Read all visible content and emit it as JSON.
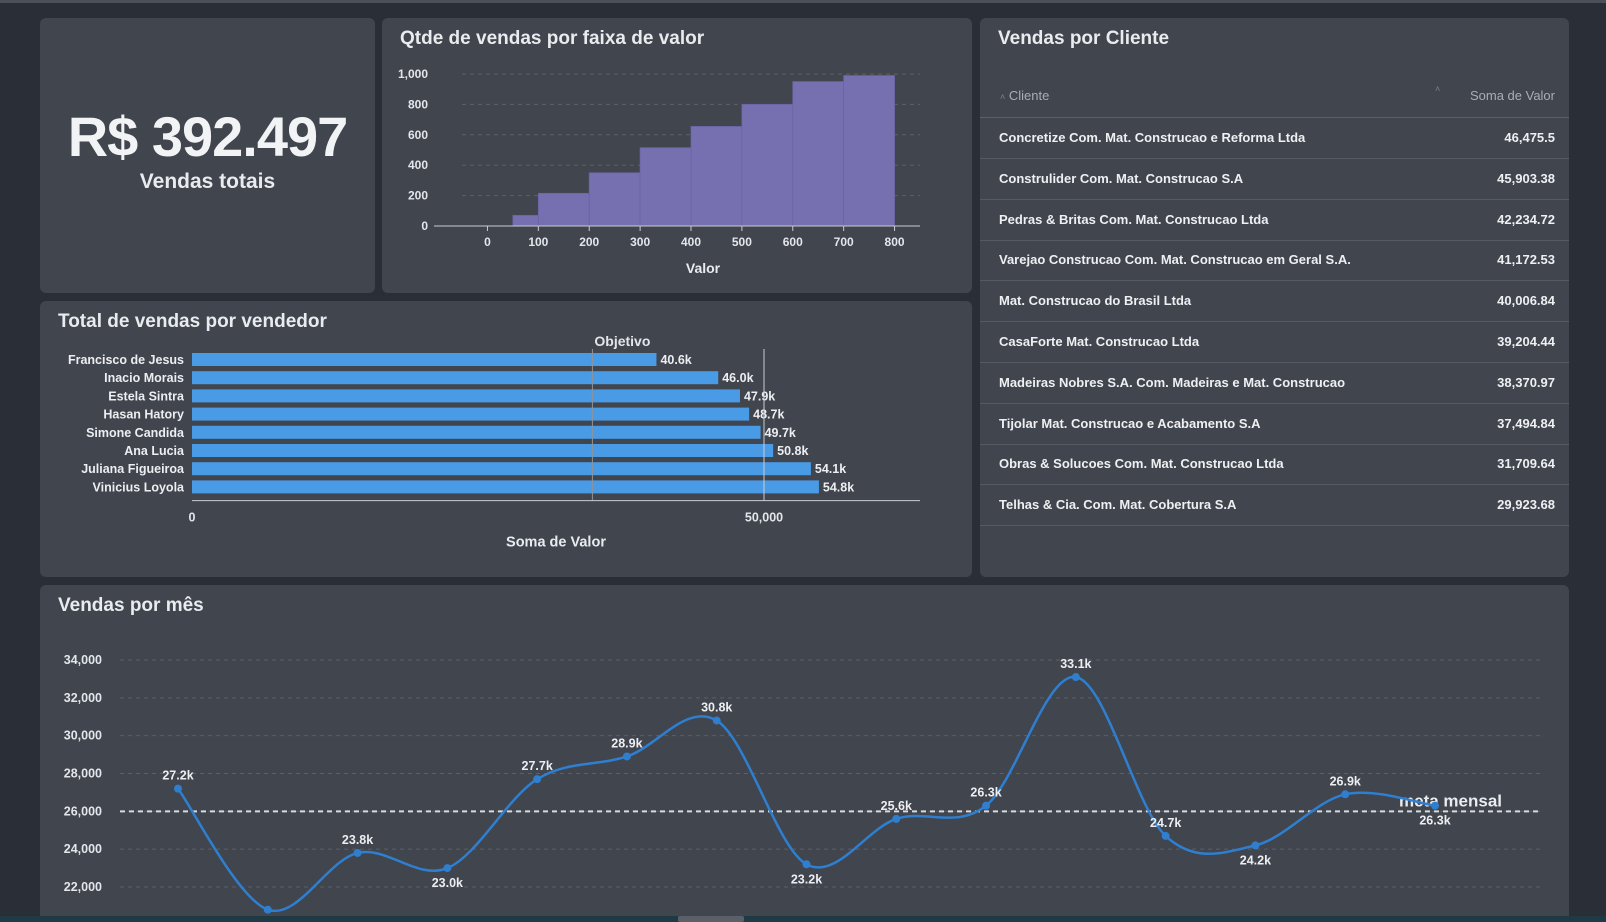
{
  "kpi": {
    "value": "R$ 392.497",
    "label": "Vendas totais"
  },
  "hist": {
    "title": "Qtde de vendas por faixa de valor",
    "chart_data": {
      "type": "bar",
      "xlabel": "Valor",
      "ylabel": "",
      "x_ticks": [
        "0",
        "100",
        "200",
        "300",
        "400",
        "500",
        "600",
        "700",
        "800"
      ],
      "y_ticks": [
        "0",
        "200",
        "400",
        "600",
        "800",
        "1,000"
      ],
      "bins": [
        [
          50,
          100
        ],
        [
          100,
          200
        ],
        [
          200,
          300
        ],
        [
          300,
          400
        ],
        [
          400,
          500
        ],
        [
          500,
          600
        ],
        [
          600,
          700
        ],
        [
          700,
          800
        ]
      ],
      "values": [
        70,
        215,
        350,
        515,
        655,
        800,
        950,
        990
      ],
      "ylim": [
        0,
        1000
      ],
      "xlim": [
        -50,
        850
      ],
      "color": "#7670b0"
    }
  },
  "sellers": {
    "title": "Total de vendas por vendedor",
    "chart_data": {
      "type": "bar",
      "orientation": "horizontal",
      "categories": [
        "Francisco de Jesus",
        "Inacio Morais",
        "Estela Sintra",
        "Hasan Hatory",
        "Simone Candida",
        "Ana Lucia",
        "Juliana Figueiroa",
        "Vinicius Loyola"
      ],
      "values": [
        40600,
        46000,
        47900,
        48700,
        49700,
        50800,
        54100,
        54800
      ],
      "labels": [
        "40.6k",
        "46.0k",
        "47.9k",
        "48.7k",
        "49.7k",
        "50.8k",
        "54.1k",
        "54.8k"
      ],
      "xlabel": "Soma de Valor",
      "x_ticks": [
        "0",
        "50,000"
      ],
      "xlim": [
        0,
        65000
      ],
      "objective_value": 35000,
      "objective_label": "Objetivo",
      "color": "#4a9be6"
    }
  },
  "clients": {
    "title": "Vendas por Cliente",
    "col_cliente": "Cliente",
    "col_valor": "Soma de Valor",
    "rows": [
      {
        "name": "Concretize Com. Mat. Construcao e Reforma Ltda",
        "value": "46,475.5"
      },
      {
        "name": "Construlider Com. Mat. Construcao S.A",
        "value": "45,903.38"
      },
      {
        "name": "Pedras & Britas Com. Mat. Construcao Ltda",
        "value": "42,234.72"
      },
      {
        "name": "Varejao Construcao Com. Mat. Construcao em Geral S.A.",
        "value": "41,172.53"
      },
      {
        "name": "Mat. Construcao do Brasil Ltda",
        "value": "40,006.84"
      },
      {
        "name": "CasaForte Mat. Construcao Ltda",
        "value": "39,204.44"
      },
      {
        "name": "Madeiras Nobres S.A. Com. Madeiras e Mat. Construcao",
        "value": "38,370.97"
      },
      {
        "name": "Tijolar Mat. Construcao e Acabamento S.A",
        "value": "37,494.84"
      },
      {
        "name": "Obras & Solucoes Com. Mat. Construcao Ltda",
        "value": "31,709.64"
      },
      {
        "name": "Telhas & Cia. Com. Mat. Cobertura S.A",
        "value": "29,923.68"
      }
    ]
  },
  "monthly": {
    "title": "Vendas por mês",
    "chart_data": {
      "type": "line",
      "y_ticks": [
        "22,000",
        "24,000",
        "26,000",
        "28,000",
        "30,000",
        "32,000",
        "34,000"
      ],
      "ylim": [
        22000,
        34000
      ],
      "values": [
        27200,
        20800,
        23800,
        23000,
        27700,
        28900,
        30800,
        23200,
        25600,
        26300,
        33100,
        24700,
        24200,
        26900,
        26300
      ],
      "labels": [
        "27.2k",
        "",
        "23.8k",
        "23.0k",
        "27.7k",
        "28.9k",
        "30.8k",
        "23.2k",
        "25.6k",
        "26.3k",
        "33.1k",
        "24.7k",
        "24.2k",
        "26.9k",
        "26.3k"
      ],
      "label_pos": [
        "above",
        "above",
        "above",
        "below",
        "above",
        "above",
        "above",
        "below",
        "above",
        "above",
        "above",
        "above",
        "below",
        "above",
        "below"
      ],
      "target_value": 26000,
      "target_label": "meta mensal",
      "color": "#2f7fd1"
    }
  }
}
